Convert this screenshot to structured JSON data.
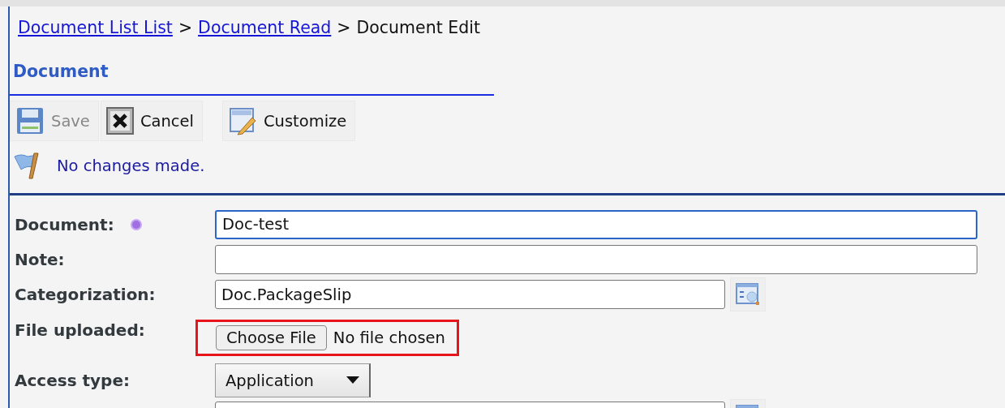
{
  "breadcrumb": [
    {
      "kind": "link",
      "label": "Document List List"
    },
    {
      "kind": "separator",
      "label": ">"
    },
    {
      "kind": "link",
      "label": "Document Read"
    },
    {
      "kind": "separator",
      "label": ">"
    },
    {
      "kind": "current",
      "label": "Document Edit"
    }
  ],
  "section_title": "Document",
  "toolbar": [
    {
      "kind": "save",
      "label": "Save",
      "disabled": true
    },
    {
      "kind": "cancel",
      "label": "Cancel",
      "disabled": false
    },
    {
      "kind": "customize",
      "label": "Customize",
      "disabled": false
    }
  ],
  "message": "No changes made.",
  "fields": [
    {
      "kind": "text",
      "label": "Document:",
      "required": true,
      "value": "Doc-test",
      "focused": true
    },
    {
      "kind": "text",
      "label": "Note:",
      "focused": false
    },
    {
      "kind": "lookup",
      "label": "Categorization:",
      "value": "Doc.PackageSlip",
      "focused": false
    },
    {
      "kind": "file",
      "label": "File uploaded:",
      "button": "Choose File",
      "status": "No file chosen",
      "highlighted": true
    },
    {
      "kind": "select",
      "label": "Access type:",
      "value": "Application"
    },
    {
      "kind": "lookup"
    }
  ]
}
